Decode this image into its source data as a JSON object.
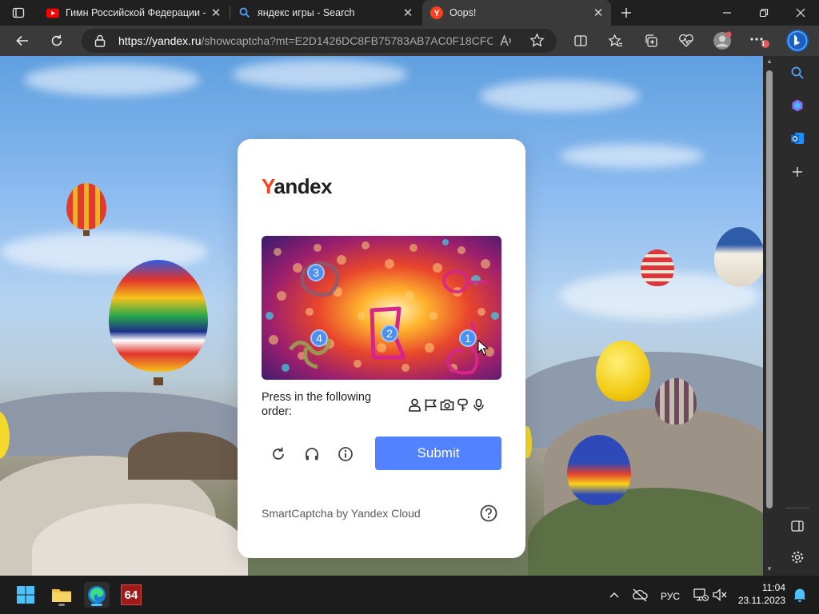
{
  "browser": {
    "tabs": [
      {
        "title": "Гимн Российской Федерации -",
        "favicon": "youtube-icon"
      },
      {
        "title": "яндекс игры - Search",
        "favicon": "bing-search-icon"
      },
      {
        "title": "Oops!",
        "favicon": "yandex-icon",
        "active": true
      }
    ],
    "url_host": "https://yandex.ru",
    "url_rest": "/showcaptcha?mt=E2D1426DC8FB75783AB7AC0F18CFC...",
    "notification_badge": "1"
  },
  "captcha": {
    "logo_first": "Y",
    "logo_rest": "andex",
    "markers": [
      "1",
      "2",
      "3",
      "4"
    ],
    "instruction": "Press in the following order:",
    "order_icons": [
      "person-icon",
      "flag-icon",
      "camera-icon",
      "key-icon",
      "microphone-icon"
    ],
    "submit_label": "Submit",
    "footer": "SmartCaptcha by Yandex Cloud"
  },
  "taskbar": {
    "app_badge": "64",
    "language": "РУС",
    "time": "11:04",
    "date": "23.11.2023"
  },
  "colors": {
    "yandex_red": "#fc3f1d",
    "submit_blue": "#5282ff",
    "marker_blue": "#4d8ff0",
    "stroke_magenta": "#d6268a"
  }
}
